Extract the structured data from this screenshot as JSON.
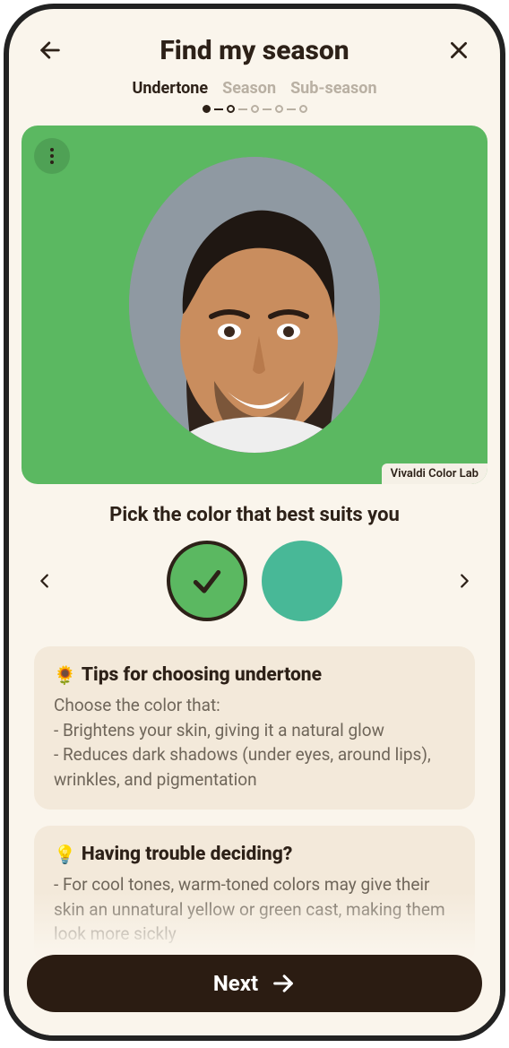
{
  "header": {
    "title": "Find my season"
  },
  "stepper": {
    "items": [
      "Undertone",
      "Season",
      "Sub-season"
    ],
    "activeIndex": 0
  },
  "photo": {
    "backgroundColor": "#5bb861",
    "watermark": "Vivaldi Color Lab"
  },
  "prompt": "Pick the color that best suits you",
  "swatches": {
    "options": [
      {
        "color": "#5bb861",
        "selected": true
      },
      {
        "color": "#48b897",
        "selected": false
      }
    ]
  },
  "tips": {
    "emoji": "🌻",
    "title": "Tips for choosing undertone",
    "intro": "Choose the color that:",
    "lines": [
      "- Brightens your skin, giving it a natural glow",
      "- Reduces dark shadows (under eyes, around lips), wrinkles, and pigmentation"
    ]
  },
  "trouble": {
    "emoji": "💡",
    "title": "Having trouble deciding?",
    "lines": [
      "- For cool tones, warm-toned colors may give their skin an unnatural yellow or green cast, making them look more sickly"
    ]
  },
  "next": {
    "label": "Next"
  }
}
